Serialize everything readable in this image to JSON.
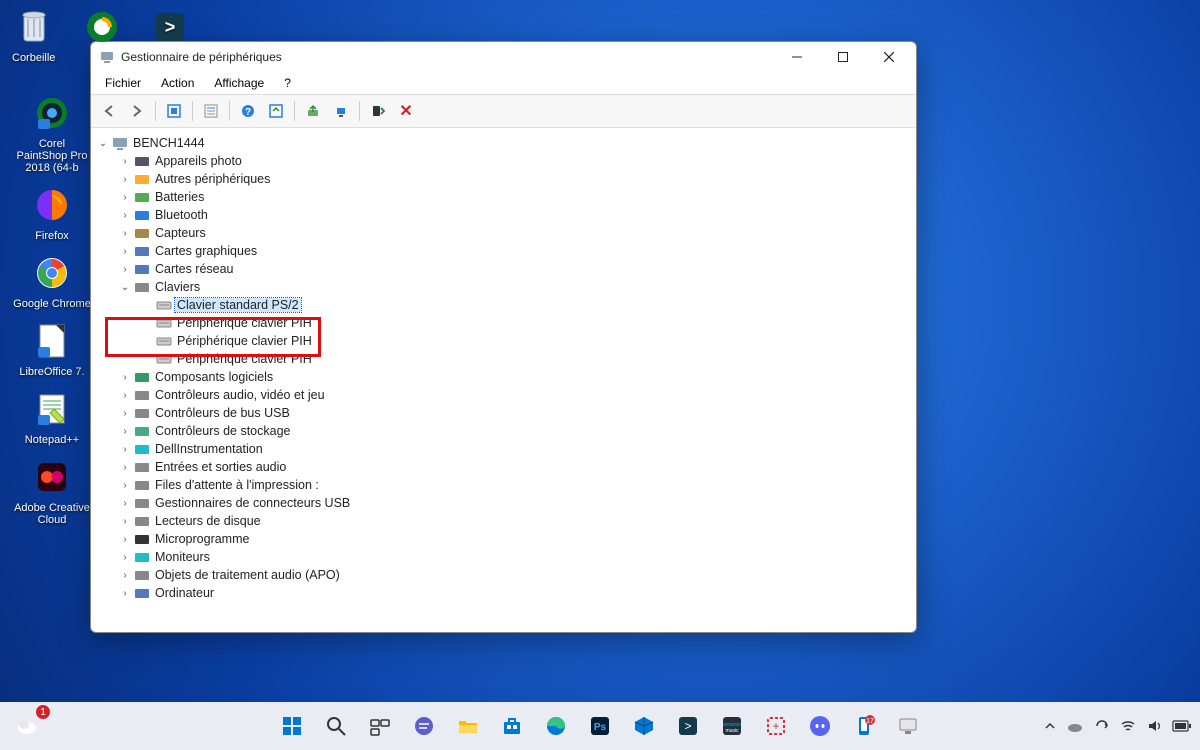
{
  "desktop": [
    {
      "label": "Corbeille",
      "icon": "bin",
      "bg": "#fff"
    },
    {
      "label": "",
      "icon": "psp",
      "bg": "#0a7d2a"
    },
    {
      "label": "",
      "icon": "psh",
      "bg": "#123a4a"
    },
    {
      "label": "Corel PaintShop Pro 2018 (64-b",
      "icon": "psp2",
      "bg": "#0a7d2a"
    },
    {
      "label": "Firefox",
      "icon": "ff",
      "bg": "#ff7b00"
    },
    {
      "label": "Google Chrome",
      "icon": "ch",
      "bg": "#fff"
    },
    {
      "label": "LibreOffice 7.",
      "icon": "lo",
      "bg": "#fff"
    },
    {
      "label": "Notepad++",
      "icon": "np",
      "bg": "#b9e34a"
    },
    {
      "label": "Adobe Creative Cloud",
      "icon": "cc",
      "bg": "#2a0010"
    }
  ],
  "window": {
    "title": "Gestionnaire de périphériques",
    "menus": [
      "Fichier",
      "Action",
      "Affichage",
      "?"
    ],
    "root": "BENCH1444",
    "categories": [
      {
        "label": "Appareils photo",
        "expanded": false,
        "icon": "cam"
      },
      {
        "label": "Autres périphériques",
        "expanded": false,
        "icon": "warn"
      },
      {
        "label": "Batteries",
        "expanded": false,
        "icon": "bat"
      },
      {
        "label": "Bluetooth",
        "expanded": false,
        "icon": "bt"
      },
      {
        "label": "Capteurs",
        "expanded": false,
        "icon": "sens"
      },
      {
        "label": "Cartes graphiques",
        "expanded": false,
        "icon": "gpu"
      },
      {
        "label": "Cartes réseau",
        "expanded": false,
        "icon": "net"
      },
      {
        "label": "Claviers",
        "expanded": true,
        "icon": "kb",
        "children": [
          {
            "label": "Clavier standard PS/2",
            "selected": true
          },
          {
            "label": "Périphérique clavier PIH"
          },
          {
            "label": "Périphérique clavier PIH"
          },
          {
            "label": "Périphérique clavier PIH"
          }
        ]
      },
      {
        "label": "Composants logiciels",
        "expanded": false,
        "icon": "sw"
      },
      {
        "label": "Contrôleurs audio, vidéo et jeu",
        "expanded": false,
        "icon": "aud"
      },
      {
        "label": "Contrôleurs de bus USB",
        "expanded": false,
        "icon": "usb"
      },
      {
        "label": "Contrôleurs de stockage",
        "expanded": false,
        "icon": "stor"
      },
      {
        "label": "DellInstrumentation",
        "expanded": false,
        "icon": "dell"
      },
      {
        "label": "Entrées et sorties audio",
        "expanded": false,
        "icon": "audio"
      },
      {
        "label": "Files d'attente à l'impression :",
        "expanded": false,
        "icon": "prn"
      },
      {
        "label": "Gestionnaires de connecteurs USB",
        "expanded": false,
        "icon": "usbc"
      },
      {
        "label": "Lecteurs de disque",
        "expanded": false,
        "icon": "disk"
      },
      {
        "label": "Microprogramme",
        "expanded": false,
        "icon": "fw"
      },
      {
        "label": "Moniteurs",
        "expanded": false,
        "icon": "mon"
      },
      {
        "label": "Objets de traitement audio (APO)",
        "expanded": false,
        "icon": "apo"
      },
      {
        "label": "Ordinateur",
        "expanded": false,
        "icon": "pc"
      }
    ]
  },
  "taskbar": {
    "center_apps": [
      "start",
      "search",
      "tasks",
      "chat",
      "files",
      "store",
      "edge",
      "ps",
      "cube",
      "sh",
      "amz",
      "snip",
      "discord",
      "phone",
      "devmgr"
    ],
    "tray": [
      "chevron",
      "onedrive",
      "sync",
      "wifi",
      "sound",
      "battery"
    ]
  }
}
